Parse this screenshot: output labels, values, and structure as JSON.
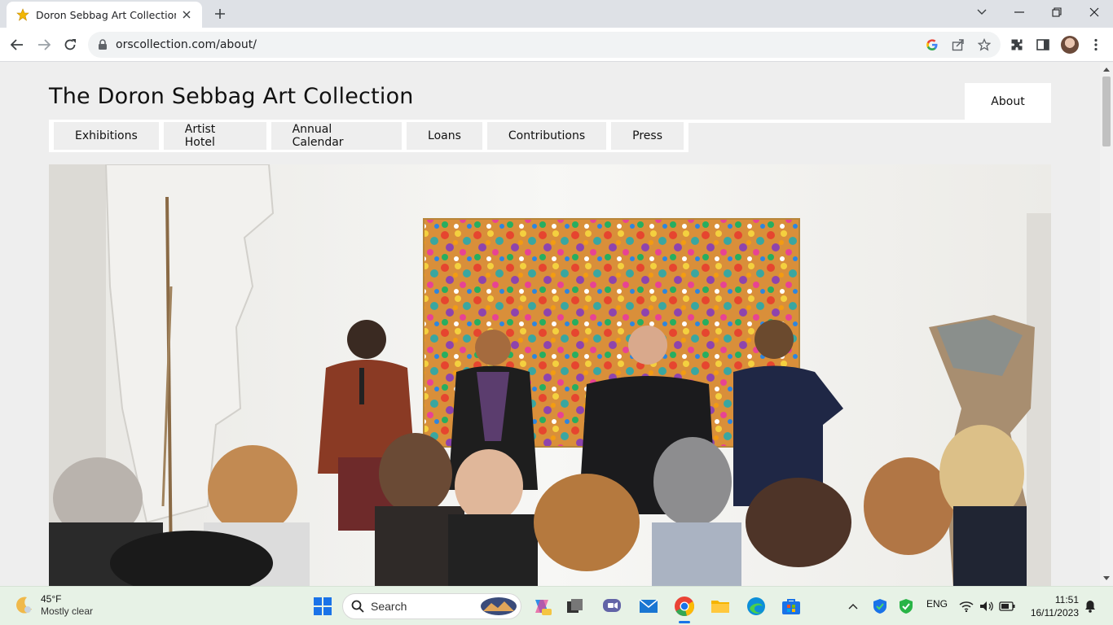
{
  "browser": {
    "tab_title": "Doron Sebbag Art Collection | o",
    "url": "orscollection.com/about/",
    "icons": [
      "star-favicon",
      "close-icon",
      "plus-icon",
      "chevron-down-icon",
      "minimize-icon",
      "restore-icon",
      "close-window-icon",
      "back-icon",
      "forward-icon",
      "reload-icon",
      "lock-icon",
      "google-icon",
      "share-icon",
      "bookmark-star-icon",
      "extensions-icon",
      "side-panel-icon",
      "profile-avatar",
      "kebab-menu-icon"
    ]
  },
  "site": {
    "title": "The Doron Sebbag Art Collection",
    "about_label": "About",
    "menu": [
      {
        "label": "Exhibitions"
      },
      {
        "label": "Artist Hotel"
      },
      {
        "label": "Annual Calendar"
      },
      {
        "label": "Loans"
      },
      {
        "label": "Contributions"
      },
      {
        "label": "Press"
      }
    ]
  },
  "taskbar": {
    "weather_temp": "45°F",
    "weather_cond": "Mostly clear",
    "search_label": "Search",
    "lang": "ENG",
    "time": "11:51",
    "date": "16/11/2023"
  },
  "colors": {
    "page_bg": "#eeeeee",
    "menu_item_bg": "#eeeeee",
    "nav_bg": "#ffffff",
    "taskbar_bg": "#e7f2e6"
  }
}
